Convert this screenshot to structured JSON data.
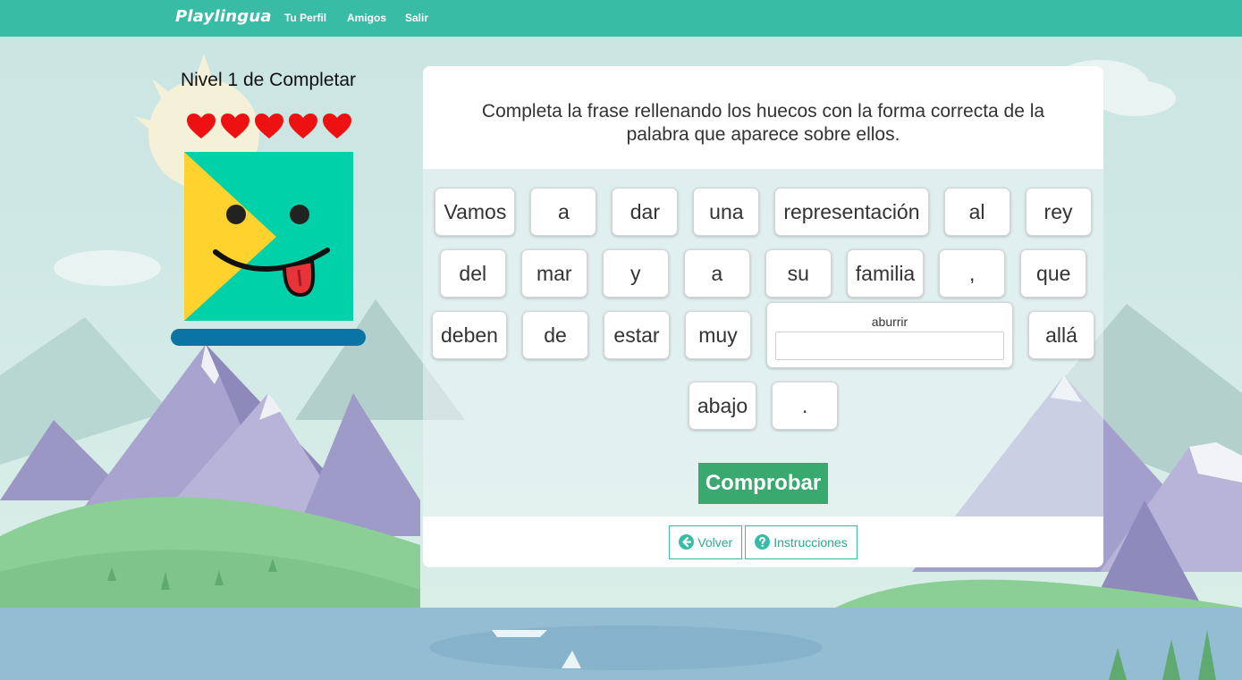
{
  "navbar": {
    "logo": "Playlingua",
    "links": [
      "Tu Perfil",
      "Amigos",
      "Salir"
    ]
  },
  "level": {
    "title": "Nivel 1 de Completar",
    "lives": 5,
    "progress": 0
  },
  "exercise": {
    "instruction": "Completa la frase rellenando los huecos con la forma correcta de la palabra que aparece sobre ellos.",
    "words_before_gap": [
      "Vamos",
      "a",
      "dar",
      "una",
      "representación",
      "al",
      "rey",
      "del",
      "mar",
      "y",
      "a",
      "su",
      "familia",
      ",",
      "que",
      "deben",
      "de",
      "estar",
      "muy"
    ],
    "gap": {
      "hint": "aburrir",
      "value": ""
    },
    "words_after_gap": [
      "allá",
      "abajo",
      "."
    ],
    "check_label": "Comprobar"
  },
  "footer": {
    "back_label": "Volver",
    "instructions_label": "Instrucciones"
  },
  "colors": {
    "brand": "#38bca6",
    "check_button": "#3aa96f",
    "hearts": "#ee1111",
    "progress_bar": "#0a74a5"
  },
  "icons": {
    "back": "arrow-circle-left-icon",
    "instructions": "question-circle-icon",
    "life": "heart-icon"
  }
}
